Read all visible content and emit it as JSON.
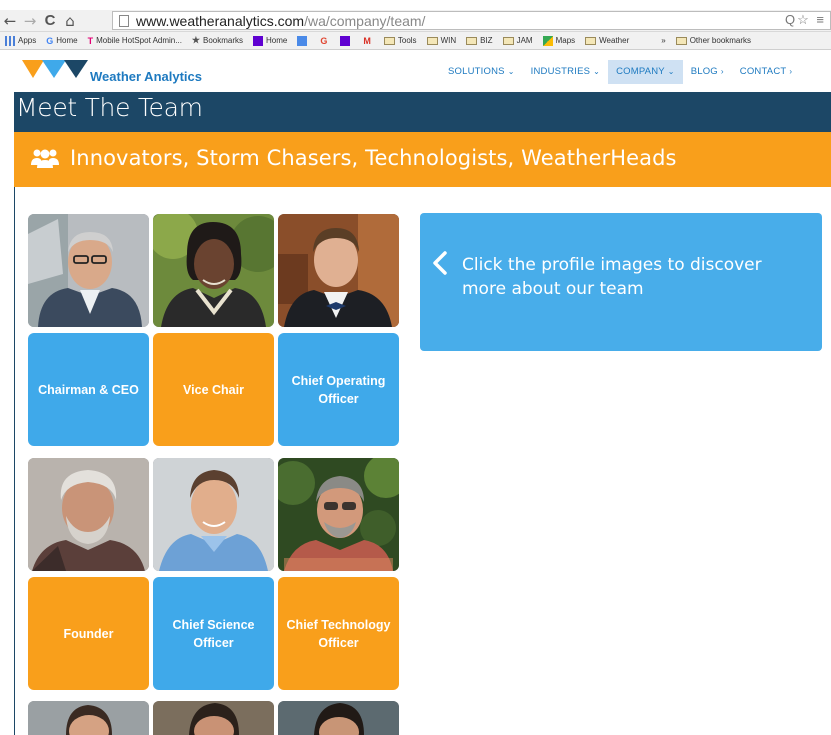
{
  "browser": {
    "url_domain": "www.weatheranalytics.com",
    "url_path": "/wa/company/team/",
    "back_label": "←",
    "forward_label": "→",
    "reload_label": "C",
    "home_label": "⌂",
    "right_icons": "Q☆ ≡",
    "bookmarks": [
      {
        "label": "Apps",
        "icon": "apps-icon"
      },
      {
        "label": "Home",
        "icon": "google-icon"
      },
      {
        "label": "Mobile HotSpot Admin...",
        "icon": "tmobile-icon"
      },
      {
        "label": "Bookmarks",
        "icon": "star-icon"
      },
      {
        "label": "Home",
        "icon": "yahoo-icon"
      },
      {
        "label": "",
        "icon": "calendar-icon"
      },
      {
        "label": "",
        "icon": "google-g-icon"
      },
      {
        "label": "",
        "icon": "yahoo-icon"
      },
      {
        "label": "",
        "icon": "gmail-icon"
      },
      {
        "label": "Tools",
        "icon": "folder-icon"
      },
      {
        "label": "WIN",
        "icon": "folder-icon"
      },
      {
        "label": "BIZ",
        "icon": "folder-icon"
      },
      {
        "label": "JAM",
        "icon": "folder-icon"
      },
      {
        "label": "Maps",
        "icon": "maps-icon"
      },
      {
        "label": "Weather",
        "icon": "folder-icon"
      }
    ],
    "overflow_label": "»",
    "other_bookmarks": "Other bookmarks"
  },
  "site": {
    "brand": "Weather Analytics",
    "menu": [
      {
        "label": "SOLUTIONS",
        "caret": "⌄",
        "active": false
      },
      {
        "label": "INDUSTRIES",
        "caret": "⌄",
        "active": false
      },
      {
        "label": "COMPANY",
        "caret": "⌄",
        "active": true
      },
      {
        "label": "BLOG",
        "caret": "›",
        "active": false
      },
      {
        "label": "CONTACT",
        "caret": "›",
        "active": false
      }
    ]
  },
  "page": {
    "title": "Meet The Team",
    "subtitle": "Innovators, Storm Chasers, Technologists, WeatherHeads",
    "info_text": "Click the profile images to discover more about our team"
  },
  "team": [
    {
      "role": "Chairman & CEO",
      "color": "#3fa9ea"
    },
    {
      "role": "Vice Chair",
      "color": "#f99f1b"
    },
    {
      "role": "Chief Operating Officer",
      "color": "#3fa9ea"
    },
    {
      "role": "Founder",
      "color": "#f99f1b"
    },
    {
      "role": "Chief Science Officer",
      "color": "#3fa9ea"
    },
    {
      "role": "Chief Technology Officer",
      "color": "#f99f1b"
    }
  ],
  "colors": {
    "navy": "#1c4766",
    "orange": "#f99f1b",
    "blue": "#3fa9ea",
    "link": "#1e7ac0"
  }
}
